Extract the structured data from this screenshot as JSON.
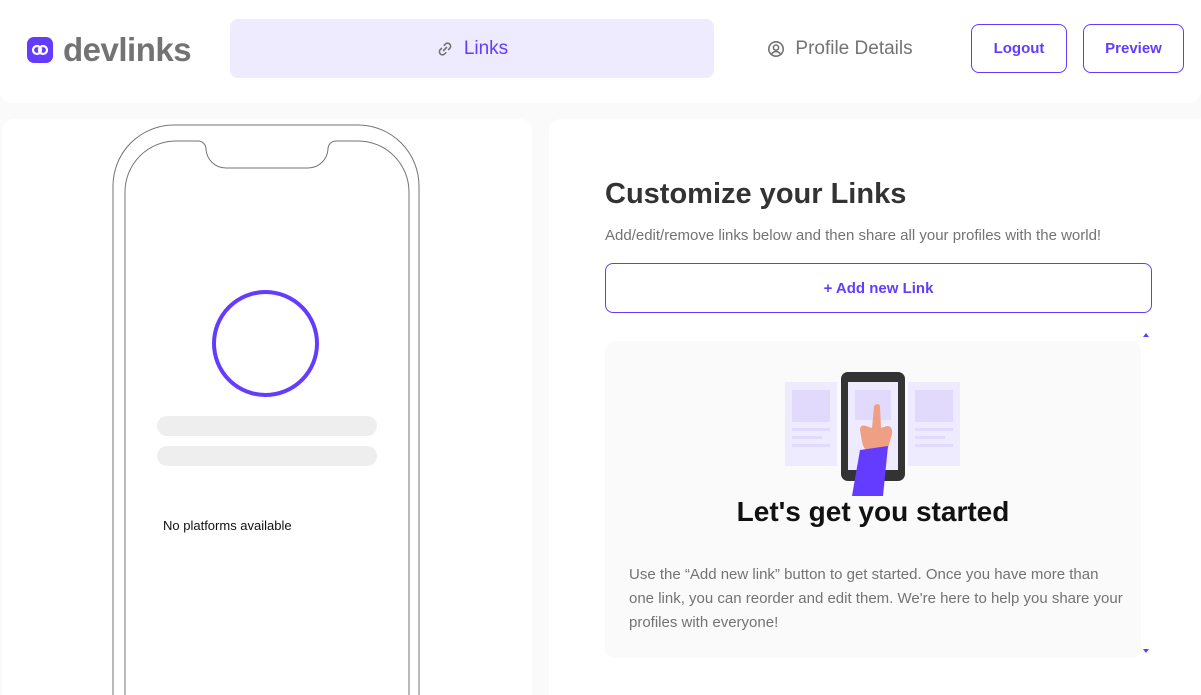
{
  "header": {
    "logo_text": "devlinks",
    "tabs": [
      {
        "label": "Links",
        "icon": "link-icon",
        "active": true
      },
      {
        "label": "Profile Details",
        "icon": "user-circle-icon",
        "active": false
      }
    ],
    "logout_label": "Logout",
    "preview_label": "Preview"
  },
  "preview": {
    "no_platforms_text": "No platforms available"
  },
  "editor": {
    "title": "Customize your Links",
    "subtitle": "Add/edit/remove links below and then share all your profiles with the world!",
    "add_link_label": "+ Add new Link",
    "empty_state": {
      "title": "Let's get you started",
      "description": "Use the “Add new link” button to get started. Once you have more than one link, you can reorder and edit them. We're here to help you share your profiles with everyone!"
    }
  },
  "colors": {
    "accent": "#633cff",
    "accent_light": "#efebff",
    "text_muted": "#737373",
    "background": "#fafafa"
  }
}
